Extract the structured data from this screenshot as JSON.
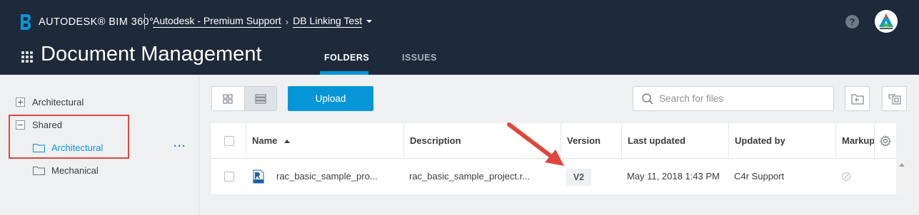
{
  "header": {
    "brand": "AUTODESK® BIM 360°",
    "breadcrumb": {
      "account": "Autodesk - Premium Support",
      "project": "DB Linking Test"
    },
    "help": "?",
    "avatar_icon": "autodesk-logo",
    "title": "Document Management",
    "tabs": [
      {
        "label": "FOLDERS",
        "active": true
      },
      {
        "label": "ISSUES",
        "active": false
      }
    ]
  },
  "sidebar": {
    "items": [
      {
        "label": "Architectural",
        "level": 0,
        "state": "collapsed"
      },
      {
        "label": "Shared",
        "level": 0,
        "state": "expanded"
      },
      {
        "label": "Architectural",
        "level": 1,
        "selected": true
      },
      {
        "label": "Mechanical",
        "level": 1,
        "selected": false
      }
    ],
    "more": "···"
  },
  "toolbar": {
    "upload_label": "Upload",
    "search_placeholder": "Search for files"
  },
  "table": {
    "columns": [
      "Name",
      "Description",
      "Version",
      "Last updated",
      "Updated by",
      "Markup"
    ],
    "sort": {
      "column": "Name",
      "direction": "ascending"
    },
    "rows": [
      {
        "name": "rac_basic_sample_pro...",
        "description": "rac_basic_sample_project.r...",
        "version": "V2",
        "last_updated": "May 11, 2018 1:43 PM",
        "updated_by": "C4r Support",
        "file_icon": "rvt-file-icon"
      }
    ]
  },
  "colors": {
    "header_bg": "#1e2a3a",
    "accent": "#0696d7",
    "annotation_red": "#e0463b"
  }
}
